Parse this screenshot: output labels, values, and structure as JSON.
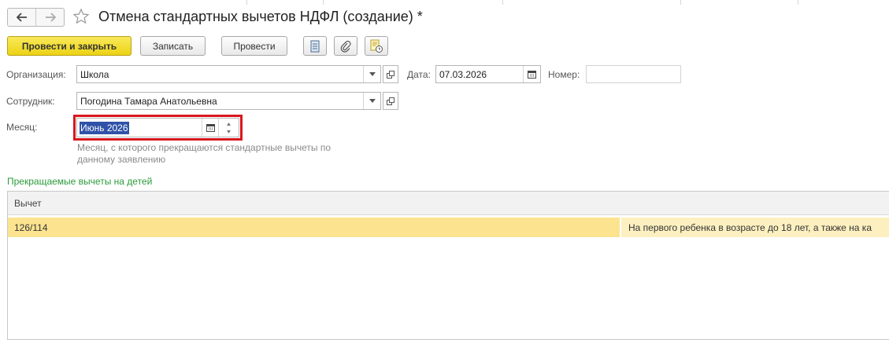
{
  "header": {
    "title": "Отмена стандартных вычетов НДФЛ (создание) *"
  },
  "toolbar": {
    "post_and_close": "Провести и закрыть",
    "save": "Записать",
    "post": "Провести"
  },
  "form": {
    "organization_label": "Организация:",
    "organization_value": "Школа",
    "date_label": "Дата:",
    "date_value": "07.03.2026",
    "number_label": "Номер:",
    "number_value": "",
    "employee_label": "Сотрудник:",
    "employee_value": "Погодина Тамара Анатольевна",
    "month_label": "Месяц:",
    "month_value": "Июнь 2026",
    "month_hint": "Месяц, с которого прекращаются стандартные вычеты по данному заявлению"
  },
  "section": {
    "title": "Прекращаемые вычеты на детей"
  },
  "table": {
    "columns": [
      "Вычет"
    ],
    "rows": [
      {
        "code": "126/114",
        "description": "На первого ребенка в возрасте до 18 лет, а также на ка"
      }
    ]
  },
  "icons": [
    "arrow-left-icon",
    "arrow-right-icon",
    "star-icon",
    "report-icon",
    "paperclip-icon",
    "document-clock-icon",
    "chevron-down-icon",
    "open-icon",
    "calendar-icon",
    "spin-icon"
  ],
  "colors": {
    "primary_button": "#f5dc32",
    "month_highlight": "#d9161c",
    "selected_text": "#2f52a8",
    "section_title": "#2a9a3a",
    "row_selected": "#fbe38f"
  }
}
